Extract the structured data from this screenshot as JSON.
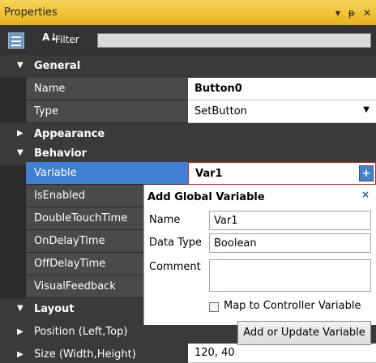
{
  "panel": {
    "title": "Properties",
    "controls": {
      "menu": "▾",
      "pin": "ᵽ",
      "close": "✕"
    }
  },
  "toolbar": {
    "sort_icon": "A↓",
    "filter_label": "Filter",
    "filter_value": ""
  },
  "sections": {
    "general": "General",
    "appearance": "Appearance",
    "behavior": "Behavior",
    "layout": "Layout"
  },
  "general": [
    {
      "name": "Name",
      "value": "Button0"
    },
    {
      "name": "Type",
      "value": "SetButton"
    }
  ],
  "behavior": [
    {
      "name": "Variable",
      "value": "Var1"
    },
    {
      "name": "IsEnabled"
    },
    {
      "name": "DoubleTouchTime"
    },
    {
      "name": "OnDelayTime"
    },
    {
      "name": "OffDelayTime"
    },
    {
      "name": "VisualFeedback"
    }
  ],
  "layout": [
    {
      "name": "Position (Left,Top)"
    },
    {
      "name": "Size (Width,Height)",
      "value": "120, 40"
    }
  ],
  "popup": {
    "title": "Add Global Variable",
    "close": "×",
    "name_label": "Name",
    "name_value": "Var1",
    "datatype_label": "Data Type",
    "datatype_value": "Boolean",
    "comment_label": "Comment",
    "comment_value": "",
    "map_label": "Map to Controller Variable",
    "map_checked": false,
    "button_label": "Add or Update Variable"
  },
  "colors": {
    "header": "#f0c22d",
    "selected": "#3f7ed0",
    "error_border": "#e01818"
  }
}
